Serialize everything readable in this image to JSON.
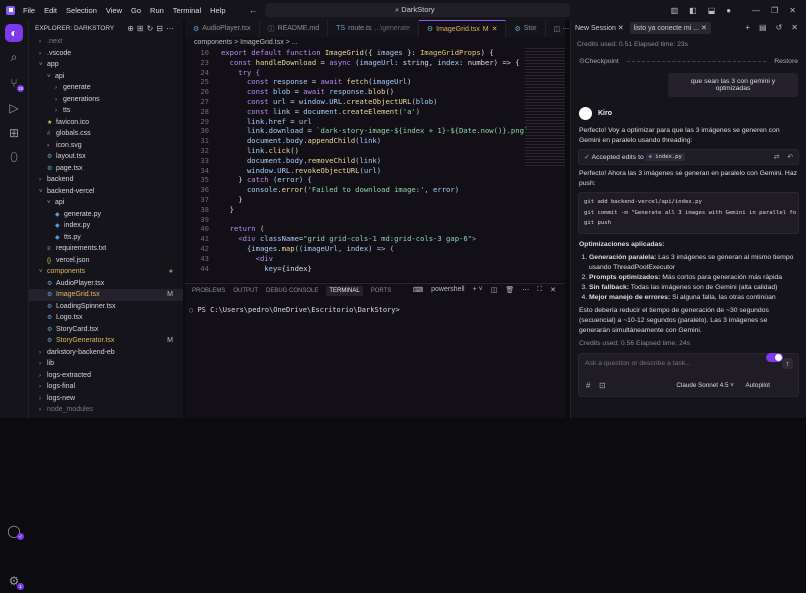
{
  "menu": [
    "File",
    "Edit",
    "Selection",
    "View",
    "Go",
    "Run",
    "Terminal",
    "Help"
  ],
  "search": "DarkStory",
  "explorer": {
    "title": "EXPLORER: DARKSTORY",
    "items": [
      {
        "label": ".next",
        "depth": 0,
        "type": "folder",
        "open": false,
        "dim": true
      },
      {
        "label": ".vscode",
        "depth": 0,
        "type": "folder",
        "open": false
      },
      {
        "label": "app",
        "depth": 0,
        "type": "folder",
        "open": true
      },
      {
        "label": "api",
        "depth": 1,
        "type": "folder",
        "open": true
      },
      {
        "label": "generate",
        "depth": 2,
        "type": "folder",
        "open": false
      },
      {
        "label": "generations",
        "depth": 2,
        "type": "folder",
        "open": false
      },
      {
        "label": "tts",
        "depth": 2,
        "type": "folder",
        "open": false
      },
      {
        "label": "favicon.ico",
        "depth": 1,
        "type": "file",
        "icon": "★",
        "color": "#e6c84a"
      },
      {
        "label": "globals.css",
        "depth": 1,
        "type": "file",
        "icon": "#",
        "color": "#4f8fd1"
      },
      {
        "label": "icon.svg",
        "depth": 1,
        "type": "file",
        "icon": "▪",
        "color": "#a25bd6"
      },
      {
        "label": "layout.tsx",
        "depth": 1,
        "type": "file",
        "icon": "⚙",
        "color": "#5fa3c7"
      },
      {
        "label": "page.tsx",
        "depth": 1,
        "type": "file",
        "icon": "⚙",
        "color": "#5fa3c7"
      },
      {
        "label": "backend",
        "depth": 0,
        "type": "folder",
        "open": false
      },
      {
        "label": "backend-vercel",
        "depth": 0,
        "type": "folder",
        "open": true
      },
      {
        "label": "api",
        "depth": 1,
        "type": "folder",
        "open": true
      },
      {
        "label": "generate.py",
        "depth": 2,
        "type": "file",
        "icon": "◆",
        "color": "#4f9ed6"
      },
      {
        "label": "index.py",
        "depth": 2,
        "type": "file",
        "icon": "◆",
        "color": "#4f9ed6"
      },
      {
        "label": "tts.py",
        "depth": 2,
        "type": "file",
        "icon": "◆",
        "color": "#4f9ed6"
      },
      {
        "label": "requirements.txt",
        "depth": 1,
        "type": "file",
        "icon": "≡",
        "color": "#aaa"
      },
      {
        "label": "vercel.json",
        "depth": 1,
        "type": "file",
        "icon": "{}",
        "color": "#e6c84a"
      },
      {
        "label": "components",
        "depth": 0,
        "type": "folder",
        "open": true,
        "color": "#e0b85a",
        "mod": "●"
      },
      {
        "label": "AudioPlayer.tsx",
        "depth": 1,
        "type": "file",
        "icon": "⚙",
        "color": "#5fa3c7"
      },
      {
        "label": "ImageGrid.tsx",
        "depth": 1,
        "type": "file",
        "icon": "⚙",
        "color": "#5fa3c7",
        "mod": "M",
        "selected": true,
        "textcolor": "#e0b85a"
      },
      {
        "label": "LoadingSpinner.tsx",
        "depth": 1,
        "type": "file",
        "icon": "⚙",
        "color": "#5fa3c7"
      },
      {
        "label": "Logo.tsx",
        "depth": 1,
        "type": "file",
        "icon": "⚙",
        "color": "#5fa3c7"
      },
      {
        "label": "StoryCard.tsx",
        "depth": 1,
        "type": "file",
        "icon": "⚙",
        "color": "#5fa3c7"
      },
      {
        "label": "StoryGenerator.tsx",
        "depth": 1,
        "type": "file",
        "icon": "⚙",
        "color": "#5fa3c7",
        "mod": "M",
        "textcolor": "#e0b85a"
      },
      {
        "label": "darkstory-backend-eb",
        "depth": 0,
        "type": "folder",
        "open": false
      },
      {
        "label": "lib",
        "depth": 0,
        "type": "folder",
        "open": false
      },
      {
        "label": "logs-extracted",
        "depth": 0,
        "type": "folder",
        "open": false
      },
      {
        "label": "logs-final",
        "depth": 0,
        "type": "folder",
        "open": false
      },
      {
        "label": "logs-new",
        "depth": 0,
        "type": "folder",
        "open": false
      },
      {
        "label": "node_modules",
        "depth": 0,
        "type": "folder",
        "open": false,
        "dim": true
      }
    ]
  },
  "activity": {
    "scm_badge": "19",
    "settings_badge": "1"
  },
  "tabs": [
    {
      "label": "AudioPlayer.tsx",
      "icon": "⚙"
    },
    {
      "label": "README.md",
      "icon": "ⓘ"
    },
    {
      "label": "route.ts",
      "extra": "...\\generate",
      "icon": "TS"
    },
    {
      "label": "ImageGrid.tsx",
      "extra": "M",
      "icon": "⚙",
      "active": true
    },
    {
      "label": "Stor",
      "icon": "⚙"
    }
  ],
  "breadcrumb": [
    "components",
    ">",
    "ImageGrid.tsx",
    ">",
    "..."
  ],
  "code": [
    {
      "n": "10",
      "t": [
        [
          "export default function ",
          "kw"
        ],
        [
          "ImageGrid",
          "fn"
        ],
        [
          "({ ",
          "pl"
        ],
        [
          "images",
          "var"
        ],
        [
          " }: ",
          "pl"
        ],
        [
          "ImageGridProps",
          "ty"
        ],
        [
          ") {",
          "pl"
        ]
      ]
    },
    {
      "n": "23",
      "t": [
        [
          "  const ",
          "kw"
        ],
        [
          "handleDownload",
          "fn"
        ],
        [
          " = ",
          "pl"
        ],
        [
          "async ",
          "kw"
        ],
        [
          "(",
          "pl"
        ],
        [
          "imageUrl",
          "var"
        ],
        [
          ": string, ",
          "pl"
        ],
        [
          "index",
          "var"
        ],
        [
          ": number) => {",
          "pl"
        ]
      ]
    },
    {
      "n": "24",
      "t": [
        [
          "    try {",
          "kw"
        ]
      ]
    },
    {
      "n": "25",
      "t": [
        [
          "      const ",
          "kw"
        ],
        [
          "response",
          "var"
        ],
        [
          " = ",
          "pl"
        ],
        [
          "await ",
          "kw"
        ],
        [
          "fetch",
          "fn"
        ],
        [
          "(",
          "pl"
        ],
        [
          "imageUrl",
          "var"
        ],
        [
          ")",
          "pl"
        ]
      ]
    },
    {
      "n": "26",
      "t": [
        [
          "      const ",
          "kw"
        ],
        [
          "blob",
          "var"
        ],
        [
          " = ",
          "pl"
        ],
        [
          "await ",
          "kw"
        ],
        [
          "response.",
          "var"
        ],
        [
          "blob",
          "fn"
        ],
        [
          "()",
          "pl"
        ]
      ]
    },
    {
      "n": "27",
      "t": [
        [
          "      const ",
          "kw"
        ],
        [
          "url",
          "var"
        ],
        [
          " = ",
          "pl"
        ],
        [
          "window.URL.",
          "var"
        ],
        [
          "createObjectURL",
          "fn"
        ],
        [
          "(blob)",
          "var"
        ]
      ]
    },
    {
      "n": "28",
      "t": [
        [
          "      const ",
          "kw"
        ],
        [
          "link",
          "var"
        ],
        [
          " = ",
          "pl"
        ],
        [
          "document.",
          "var"
        ],
        [
          "createElement",
          "fn"
        ],
        [
          "('a')",
          "str"
        ]
      ]
    },
    {
      "n": "29",
      "t": [
        [
          "      link.href",
          "var"
        ],
        [
          " = ",
          "pl"
        ],
        [
          "url",
          "var"
        ]
      ]
    },
    {
      "n": "30",
      "t": [
        [
          "      link.download",
          "var"
        ],
        [
          " = ",
          "pl"
        ],
        [
          "`dark-story-image-${index + 1}-${Date.now()}.png`",
          "str"
        ]
      ]
    },
    {
      "n": "31",
      "t": [
        [
          "      document.body.",
          "var"
        ],
        [
          "appendChild",
          "fn"
        ],
        [
          "(link)",
          "var"
        ]
      ]
    },
    {
      "n": "32",
      "t": [
        [
          "      link.",
          "var"
        ],
        [
          "click",
          "fn"
        ],
        [
          "()",
          "pl"
        ]
      ]
    },
    {
      "n": "33",
      "t": [
        [
          "      document.body.",
          "var"
        ],
        [
          "removeChild",
          "fn"
        ],
        [
          "(link)",
          "var"
        ]
      ]
    },
    {
      "n": "34",
      "t": [
        [
          "      window.URL.",
          "var"
        ],
        [
          "revokeObjectURL",
          "fn"
        ],
        [
          "(url)",
          "var"
        ]
      ]
    },
    {
      "n": "35",
      "t": [
        [
          "    } ",
          "pl"
        ],
        [
          "catch ",
          "kw"
        ],
        [
          "(error) {",
          "var"
        ]
      ]
    },
    {
      "n": "36",
      "t": [
        [
          "      console.",
          "var"
        ],
        [
          "error",
          "fn"
        ],
        [
          "(",
          "pl"
        ],
        [
          "'Failed to download image:'",
          "str"
        ],
        [
          ", error)",
          "var"
        ]
      ]
    },
    {
      "n": "37",
      "t": [
        [
          "    }",
          "pl"
        ]
      ]
    },
    {
      "n": "38",
      "t": [
        [
          "  }",
          "pl"
        ]
      ]
    },
    {
      "n": "39",
      "t": [
        [
          "",
          "pl"
        ]
      ]
    },
    {
      "n": "40",
      "t": [
        [
          "  return ",
          "kw"
        ],
        [
          "(",
          "pl"
        ]
      ]
    },
    {
      "n": "41",
      "t": [
        [
          "    <div ",
          "kw"
        ],
        [
          "className",
          "var"
        ],
        [
          "=",
          "pl"
        ],
        [
          "\"grid grid-cols-1 md:grid-cols-3 gap-6\"",
          "str"
        ],
        [
          ">",
          "kw"
        ]
      ]
    },
    {
      "n": "42",
      "t": [
        [
          "      {images.",
          "var"
        ],
        [
          "map",
          "fn"
        ],
        [
          "((imageUrl, index) => (",
          "var"
        ]
      ]
    },
    {
      "n": "43",
      "t": [
        [
          "        <div",
          "kw"
        ]
      ]
    },
    {
      "n": "44",
      "t": [
        [
          "          key",
          "var"
        ],
        [
          "={index}",
          "pl"
        ]
      ]
    }
  ],
  "panel": {
    "tabs": [
      "PROBLEMS",
      "OUTPUT",
      "DEBUG CONSOLE",
      "TERMINAL",
      "PORTS"
    ],
    "active": "TERMINAL",
    "shell": "powershell",
    "prompt": "PS C:\\Users\\pedro\\OneDrive\\Escritorio\\DarkStory>"
  },
  "chat": {
    "tabs": [
      "New Session",
      "listo ya conecte mi ..."
    ],
    "credits1": "Credits used: 0.51   Elapsed time: 23s",
    "checkpoint": "Checkpoint",
    "restore": "Restore",
    "user_msg": "que sean las 3 con gemini y optmizadas",
    "agent": "Kiro",
    "p1": "Perfecto! Voy a optimizar para que las 3 imágenes se generen con Gemini en paralelo usando threading:",
    "accepted": "Accepted edits to",
    "file": "index.py",
    "p2": "Perfecto! Ahora las 3 imágenes se generan en paralelo con Gemini. Haz push:",
    "git": [
      "git add backend-vercel/api/index.py",
      "git commit -m \"Generate all 3 images with Gemini in parallel fo",
      "git push"
    ],
    "heading": "Optimizaciones aplicadas:",
    "list": [
      {
        "b": "Generación paralela:",
        "t": " Las 3 imágenes se generan al mismo tiempo usando ThreadPoolExecutor"
      },
      {
        "b": "Prompts optimizados:",
        "t": " Más cortos para generación más rápida"
      },
      {
        "b": "Sin fallback:",
        "t": " Todas las imágenes son de Gemini (alta calidad)"
      },
      {
        "b": "Mejor manejo de errores:",
        "t": " Si alguna falla, las otras continúan"
      }
    ],
    "p3": "Esto debería reducir el tiempo de generación de ~30 segundos (secuencial) a ~10-12 segundos (paralelo). Las 3 imágenes se generarán simultáneamente con Gemini.",
    "credits2": "Credits used: 0.56   Elapsed time: 24s",
    "placeholder": "Ask a question or describe a task...",
    "model": "Claude Sonnet 4.5",
    "autopilot": "Autopilot"
  }
}
